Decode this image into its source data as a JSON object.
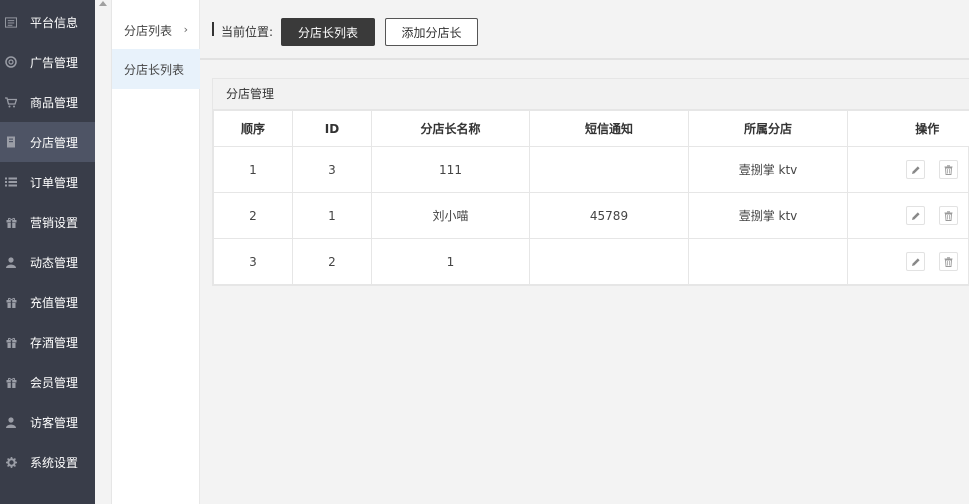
{
  "sidebar": {
    "items": [
      {
        "label": "平台信息",
        "icon": "platform-icon",
        "active": false
      },
      {
        "label": "广告管理",
        "icon": "ad-icon",
        "active": false
      },
      {
        "label": "商品管理",
        "icon": "cart-icon",
        "active": false
      },
      {
        "label": "分店管理",
        "icon": "store-icon",
        "active": true
      },
      {
        "label": "订单管理",
        "icon": "list-icon",
        "active": false
      },
      {
        "label": "营销设置",
        "icon": "gift-icon",
        "active": false
      },
      {
        "label": "动态管理",
        "icon": "user-icon",
        "active": false
      },
      {
        "label": "充值管理",
        "icon": "gift-icon",
        "active": false
      },
      {
        "label": "存酒管理",
        "icon": "gift-icon",
        "active": false
      },
      {
        "label": "会员管理",
        "icon": "gift-icon",
        "active": false
      },
      {
        "label": "访客管理",
        "icon": "user-icon",
        "active": false
      },
      {
        "label": "系统设置",
        "icon": "gear-icon",
        "active": false
      }
    ]
  },
  "submenu": {
    "items": [
      {
        "label": "分店列表",
        "chevron": "›"
      },
      {
        "label": "分店长列表",
        "chevron": ""
      }
    ]
  },
  "topbar": {
    "position_label": "当前位置:",
    "primary_button": "分店长列表",
    "secondary_button": "添加分店长"
  },
  "panel": {
    "title": "分店管理",
    "columns": [
      "顺序",
      "ID",
      "分店长名称",
      "短信通知",
      "所属分店",
      "操作"
    ],
    "rows": [
      {
        "order": "1",
        "id": "3",
        "name": "111",
        "sms": "",
        "store": "壹捌掌 ktv"
      },
      {
        "order": "2",
        "id": "1",
        "name": "刘小喵",
        "sms": "45789",
        "store": "壹捌掌 ktv"
      },
      {
        "order": "3",
        "id": "2",
        "name": "1",
        "sms": "",
        "store": ""
      }
    ]
  },
  "colors": {
    "sidebar_bg": "#393d49",
    "sidebar_active": "#4e5465",
    "submenu_active": "#e8f2fb",
    "primary_button": "#3a3a3a"
  }
}
